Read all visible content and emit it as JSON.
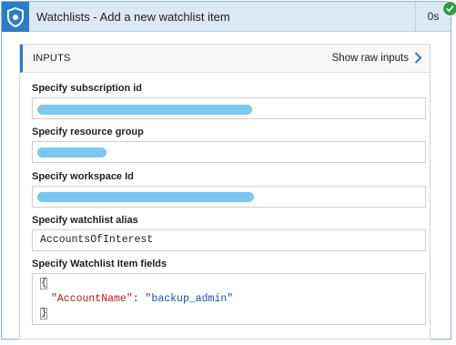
{
  "window": {
    "title": "Watchlists - Add a new watchlist item",
    "duration": "0s",
    "status_icon": "check-icon",
    "logo_icon": "sentinel-shield-icon"
  },
  "inputs": {
    "title": "INPUTS",
    "raw_link": "Show raw inputs",
    "fields": [
      {
        "label": "Specify subscription id",
        "value": ""
      },
      {
        "label": "Specify resource group",
        "value": ""
      },
      {
        "label": "Specify workspace Id",
        "value": ""
      },
      {
        "label": "Specify watchlist alias",
        "value": "AccountsOfInterest"
      }
    ],
    "item_fields": {
      "label": "Specify Watchlist Item fields",
      "open_brace": "{",
      "close_brace": "}",
      "key": "\"AccountName\"",
      "separator": ": ",
      "value": "\"backup_admin\""
    }
  },
  "colors": {
    "accent": "#2a7dc8",
    "header_bg": "#dbe9f6",
    "redaction": "#7cc7ef",
    "success": "#2f9e44"
  }
}
